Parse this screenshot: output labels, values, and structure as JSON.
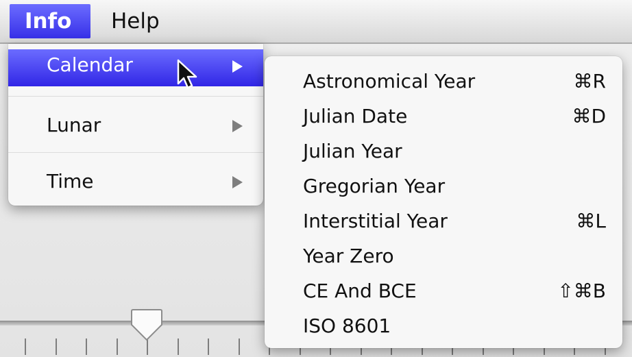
{
  "menubar": {
    "items": [
      {
        "label": "Info"
      },
      {
        "label": "Help"
      }
    ]
  },
  "menu": {
    "items": [
      {
        "label": "Calendar"
      },
      {
        "label": "Lunar"
      },
      {
        "label": "Time"
      }
    ]
  },
  "submenu": {
    "items": [
      {
        "label": "Astronomical Year",
        "shortcut": "⌘R"
      },
      {
        "label": "Julian Date",
        "shortcut": "⌘D"
      },
      {
        "label": "Julian Year",
        "shortcut": ""
      },
      {
        "label": "Gregorian Year",
        "shortcut": ""
      },
      {
        "label": "Interstitial Year",
        "shortcut": "⌘L"
      },
      {
        "label": "Year Zero",
        "shortcut": ""
      },
      {
        "label": "CE And BCE",
        "shortcut": "⇧⌘B"
      },
      {
        "label": "ISO 8601",
        "shortcut": ""
      }
    ]
  },
  "icons": {
    "cursor": "arrow-cursor-icon",
    "submenu_arrow": "chevron-right-icon",
    "slider_thumb": "slider-thumb-icon"
  },
  "colors": {
    "highlight": "#3d35ea",
    "menu_bg": "#f7f7f7"
  }
}
